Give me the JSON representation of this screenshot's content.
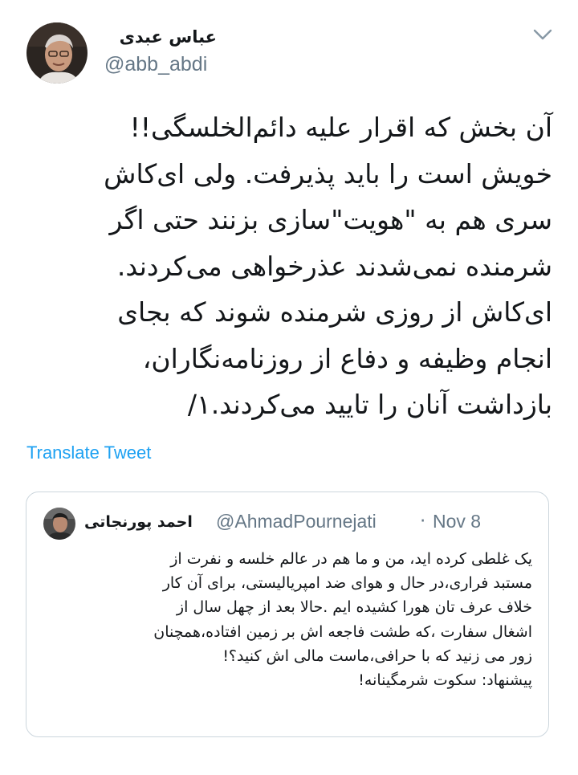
{
  "tweet": {
    "author": {
      "name": "عباس عبدی",
      "handle": "@abb_abdi"
    },
    "text_lines": [
      "آن بخش که اقرار علیه دائم‌الخلسگی!!",
      "خویش است را باید پذیرفت. ولی ای‌کاش",
      "سری هم به \"هویت\"سازی بزنند حتی اگر",
      "شرمنده نمی‌شدند عذرخواهی می‌کردند.",
      "ای‌کاش از روزی شرمنده شوند که بجای",
      "انجام وظیفه و دفاع از روزنامه‌نگاران،",
      "بازداشت آنان را تایید می‌کردند.۱/"
    ],
    "translate_label": "Translate Tweet",
    "menu_icon": "chevron-down-icon"
  },
  "quoted": {
    "name": "احمد پورنجاتی",
    "handle": "@AhmadPournejati",
    "separator": "·",
    "date": "Nov 8",
    "text_lines": [
      "یک غلطی کرده اید، من و ما هم در عالم خلسه و نفرت از",
      "مستبد فراری،در حال و هوای ضد امپریالیستی، برای آن کار",
      "خلاف عرف تان هورا کشیده ایم .حالا بعد از چهل سال از",
      "اشغال سفارت ،که طشت فاجعه اش بر زمین افتاده،همچنان",
      "زور می زنید که با حرافی،ماست مالی اش کنید؟!",
      "پیشنهاد: سکوت شرمگینانه!"
    ]
  },
  "colors": {
    "text": "#14171a",
    "secondary": "#657786",
    "link": "#1da1f2",
    "border": "#ccd6dd"
  }
}
